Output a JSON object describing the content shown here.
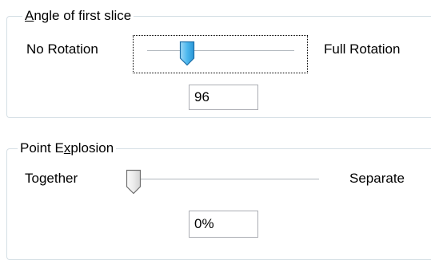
{
  "angle": {
    "legend_prefix": "",
    "legend_mnemonic": "A",
    "legend_rest": "ngle of first slice",
    "min_label": "No Rotation",
    "max_label": "Full Rotation",
    "value": "96",
    "slider_fraction": 0.27
  },
  "explosion": {
    "legend_prefix": "Point E",
    "legend_mnemonic": "x",
    "legend_rest": "plosion",
    "min_label": "Together",
    "max_label": "Separate",
    "value": "0%",
    "slider_fraction": 0.0
  },
  "colors": {
    "thumb_focused": "#35a6e3",
    "thumb_normal": "#e8e8e8",
    "border": "#d5dfe5"
  },
  "icons": {
    "focused_thumb": "slider-thumb-icon",
    "normal_thumb": "slider-thumb-icon"
  }
}
